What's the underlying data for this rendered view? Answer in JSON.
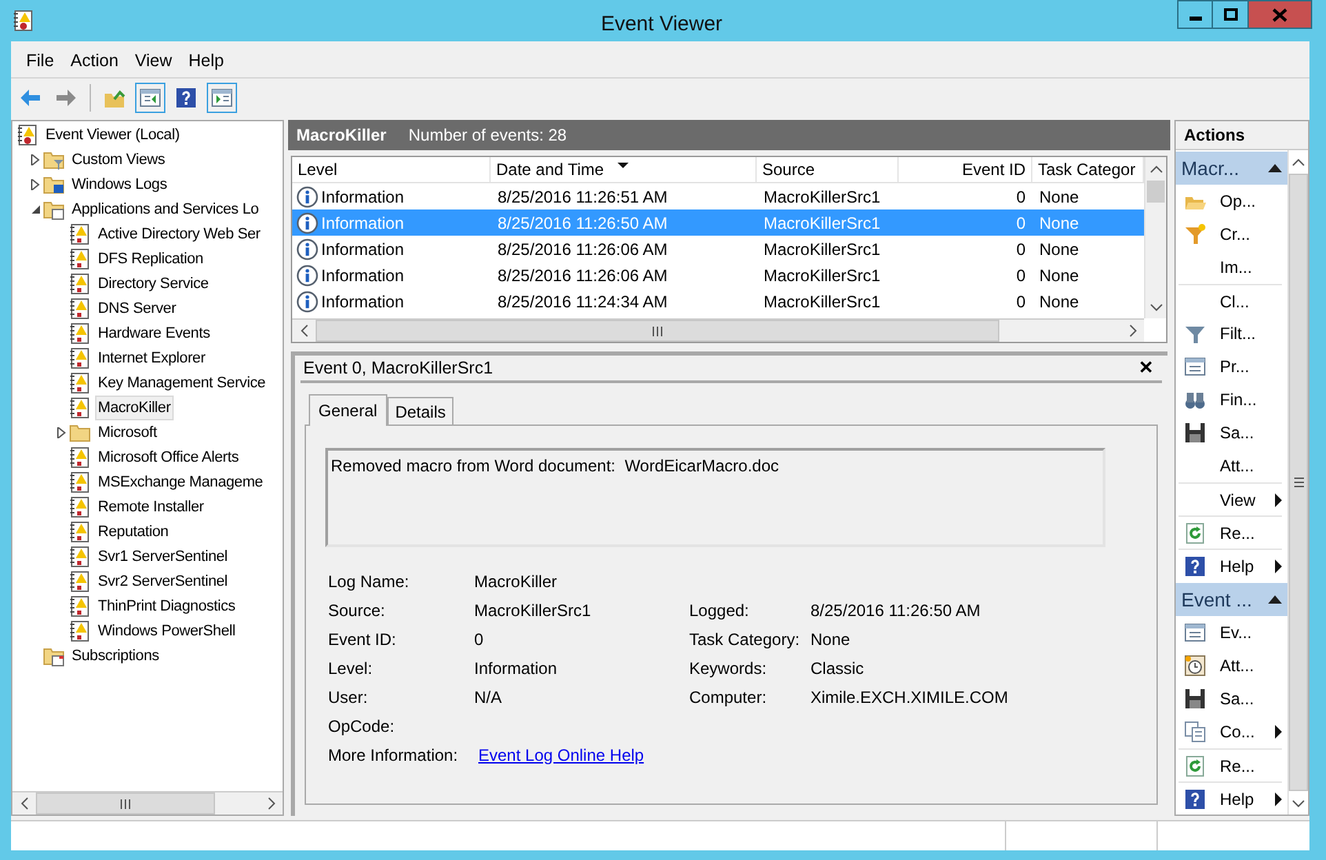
{
  "window": {
    "title": "Event Viewer"
  },
  "menu": [
    "File",
    "Action",
    "View",
    "Help"
  ],
  "tree": [
    {
      "label": "Event Viewer (Local)",
      "kind": "root",
      "selected": false,
      "children": [
        {
          "label": "Custom Views",
          "kind": "filter-folder",
          "selected": false,
          "expanded": false
        },
        {
          "label": "Windows Logs",
          "kind": "windows-folder",
          "selected": false,
          "expanded": false
        },
        {
          "label": "Applications and Services Lo",
          "kind": "open-folder",
          "selected": false,
          "expanded": true,
          "children": [
            {
              "label": "Active Directory Web Ser",
              "kind": "log",
              "selected": false
            },
            {
              "label": "DFS Replication",
              "kind": "log",
              "selected": false
            },
            {
              "label": "Directory Service",
              "kind": "log",
              "selected": false
            },
            {
              "label": "DNS Server",
              "kind": "log",
              "selected": false
            },
            {
              "label": "Hardware Events",
              "kind": "log",
              "selected": false
            },
            {
              "label": "Internet Explorer",
              "kind": "log",
              "selected": false
            },
            {
              "label": "Key Management Service",
              "kind": "log",
              "selected": false
            },
            {
              "label": "MacroKiller",
              "kind": "log",
              "selected": true
            },
            {
              "label": "Microsoft",
              "kind": "folder",
              "selected": false,
              "expanded": false
            },
            {
              "label": "Microsoft Office Alerts",
              "kind": "log",
              "selected": false
            },
            {
              "label": "MSExchange Manageme",
              "kind": "log",
              "selected": false
            },
            {
              "label": "Remote Installer",
              "kind": "log",
              "selected": false
            },
            {
              "label": "Reputation",
              "kind": "log",
              "selected": false
            },
            {
              "label": "Svr1 ServerSentinel",
              "kind": "log",
              "selected": false
            },
            {
              "label": "Svr2 ServerSentinel",
              "kind": "log",
              "selected": false
            },
            {
              "label": "ThinPrint Diagnostics",
              "kind": "log",
              "selected": false
            },
            {
              "label": "Windows PowerShell",
              "kind": "log",
              "selected": false
            }
          ]
        },
        {
          "label": "Subscriptions",
          "kind": "subscriptions",
          "selected": false
        }
      ]
    }
  ],
  "log_header": {
    "name": "MacroKiller",
    "count": "Number of events: 28"
  },
  "events": {
    "columns": [
      {
        "label": "Level",
        "sorted": false
      },
      {
        "label": "Date and Time",
        "sorted": true
      },
      {
        "label": "Source",
        "sorted": false
      },
      {
        "label": "Event ID",
        "sorted": false
      },
      {
        "label": "Task Categor",
        "sorted": false
      }
    ],
    "rows": [
      {
        "cells": [
          "Information",
          "8/25/2016 11:26:51 AM",
          "MacroKillerSrc1",
          "0",
          "None"
        ],
        "selected": false
      },
      {
        "cells": [
          "Information",
          "8/25/2016 11:26:50 AM",
          "MacroKillerSrc1",
          "0",
          "None"
        ],
        "selected": true
      },
      {
        "cells": [
          "Information",
          "8/25/2016 11:26:06 AM",
          "MacroKillerSrc1",
          "0",
          "None"
        ],
        "selected": false
      },
      {
        "cells": [
          "Information",
          "8/25/2016 11:26:06 AM",
          "MacroKillerSrc1",
          "0",
          "None"
        ],
        "selected": false
      },
      {
        "cells": [
          "Information",
          "8/25/2016 11:24:34 AM",
          "MacroKillerSrc1",
          "0",
          "None"
        ],
        "selected": false
      }
    ]
  },
  "details": {
    "title": "Event 0, MacroKillerSrc1",
    "close": "✕",
    "tabs": [
      {
        "label": "General",
        "selected": true
      },
      {
        "label": "Details",
        "selected": false
      }
    ],
    "description": "Removed macro from Word document:  WordEicarMacro.doc",
    "fields_left": [
      {
        "label": "Log Name:",
        "value": "MacroKiller"
      },
      {
        "label": "Source:",
        "value": "MacroKillerSrc1"
      },
      {
        "label": "Event ID:",
        "value": "0"
      },
      {
        "label": "Level:",
        "value": "Information"
      },
      {
        "label": "User:",
        "value": "N/A"
      },
      {
        "label": "OpCode:"
      }
    ],
    "fields_right": [
      {
        "label": "Logged:",
        "value": "8/25/2016 11:26:50 AM"
      },
      {
        "label": "Task Category:",
        "value": "None"
      },
      {
        "label": "Keywords:",
        "value": "Classic"
      },
      {
        "label": "Computer:",
        "value": "Ximile.EXCH.XIMILE.COM"
      }
    ],
    "more_info": {
      "label": "More Information:",
      "link": "Event Log Online Help"
    }
  },
  "actions": {
    "title": "Actions",
    "sections": [
      {
        "title": "Macr...",
        "expanded": true,
        "items": [
          {
            "label": "Op...",
            "kind": "open-folder",
            "submenu": false,
            "divider_before": false
          },
          {
            "label": "Cr...",
            "kind": "funnel-star",
            "submenu": false,
            "divider_before": false
          },
          {
            "label": "Im...",
            "kind": "plain",
            "submenu": false,
            "divider_before": false
          },
          {
            "label": "Cl...",
            "kind": "plain",
            "submenu": false,
            "divider_before": true
          },
          {
            "label": "Filt...",
            "kind": "funnel",
            "submenu": false,
            "divider_before": false
          },
          {
            "label": "Pr...",
            "kind": "properties",
            "submenu": false,
            "divider_before": false
          },
          {
            "label": "Fin...",
            "kind": "binoculars",
            "submenu": false,
            "divider_before": false
          },
          {
            "label": "Sa...",
            "kind": "save",
            "submenu": false,
            "divider_before": false
          },
          {
            "label": "Att...",
            "kind": "plain",
            "submenu": false,
            "divider_before": false
          },
          {
            "label": "View",
            "kind": "plain",
            "submenu": true,
            "divider_before": true
          },
          {
            "label": "Re...",
            "kind": "refresh",
            "submenu": false,
            "divider_before": true
          },
          {
            "label": "Help",
            "kind": "help",
            "submenu": true,
            "divider_before": true
          }
        ]
      },
      {
        "title": "Event ...",
        "expanded": true,
        "items": [
          {
            "label": "Ev...",
            "kind": "properties",
            "submenu": false,
            "divider_before": false
          },
          {
            "label": "Att...",
            "kind": "clock",
            "submenu": false,
            "divider_before": false
          },
          {
            "label": "Sa...",
            "kind": "save",
            "submenu": false,
            "divider_before": false
          },
          {
            "label": "Co...",
            "kind": "copy",
            "submenu": true,
            "divider_before": false
          },
          {
            "label": "Re...",
            "kind": "refresh",
            "submenu": false,
            "divider_before": true
          },
          {
            "label": "Help",
            "kind": "help",
            "submenu": true,
            "divider_before": true
          }
        ]
      }
    ]
  }
}
